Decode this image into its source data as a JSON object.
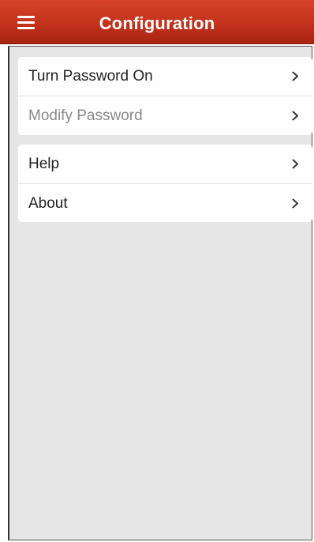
{
  "header": {
    "title": "Configuration",
    "menu_icon": "hamburger-menu-icon",
    "background_color": "#c2321c",
    "title_color": "#ffffff"
  },
  "groups": [
    {
      "items": [
        {
          "label": "Turn Password On",
          "enabled": true,
          "icon": "chevron-right-icon"
        },
        {
          "label": "Modify Password",
          "enabled": false,
          "icon": "chevron-right-icon"
        }
      ]
    },
    {
      "items": [
        {
          "label": "Help",
          "enabled": true,
          "icon": "chevron-right-icon"
        },
        {
          "label": "About",
          "enabled": true,
          "icon": "chevron-right-icon"
        }
      ]
    }
  ],
  "colors": {
    "content_background": "#e6e6e6",
    "item_text": "#222222",
    "disabled_text": "#8a8a8a"
  }
}
